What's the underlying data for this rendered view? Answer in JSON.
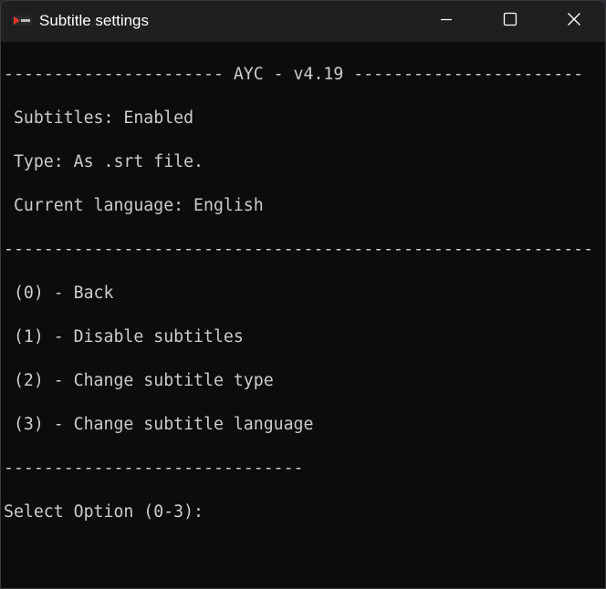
{
  "window": {
    "title": "Subtitle settings",
    "controls": {
      "minimize": "minimize",
      "maximize": "maximize",
      "close": "close"
    }
  },
  "console": {
    "header_rule": "---------------------- AYC - v4.19 -----------------------",
    "status": [
      " Subtitles: Enabled",
      " Type: As .srt file.",
      " Current language: English"
    ],
    "divider_rule": "-----------------------------------------------------------",
    "options": [
      " (0) - Back",
      " (1) - Disable subtitles",
      " (2) - Change subtitle type",
      " (3) - Change subtitle language"
    ],
    "footer_rule": "------------------------------",
    "prompt": "Select Option (0-3):"
  },
  "colors": {
    "console_bg": "#0c0c0c",
    "console_text": "#cccccc",
    "titlebar_bg": "#1f1f1f",
    "app_icon": "#e0342b"
  }
}
